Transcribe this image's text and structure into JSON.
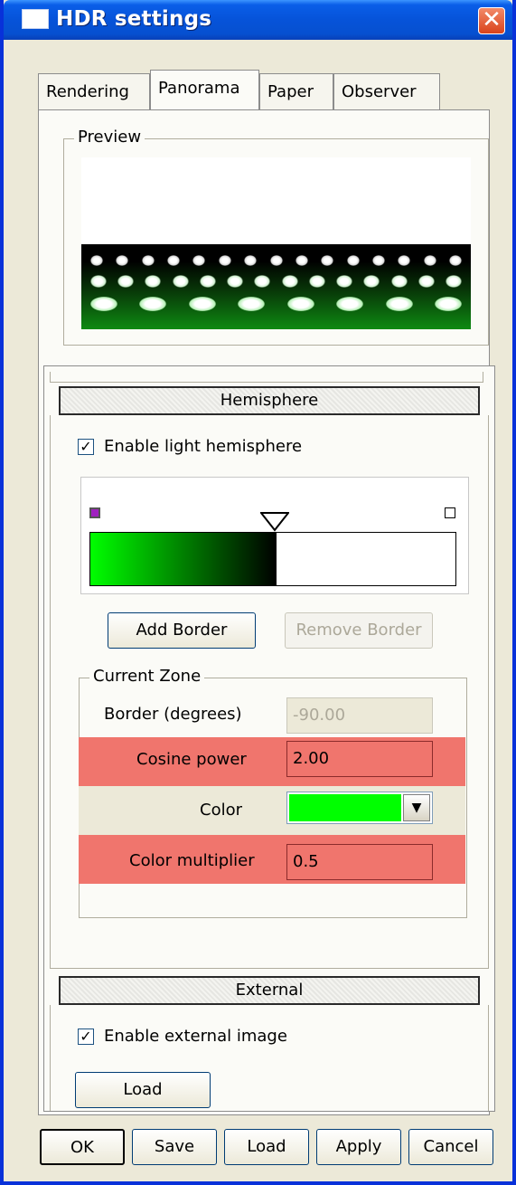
{
  "window": {
    "title": "HDR settings",
    "close_glyph": "✕"
  },
  "tabs": [
    {
      "label": "Rendering"
    },
    {
      "label": "Panorama"
    },
    {
      "label": "Paper"
    },
    {
      "label": "Observer"
    }
  ],
  "preview": {
    "title": "Preview"
  },
  "hemisphere": {
    "header": "Hemisphere",
    "enable_checked": true,
    "enable_label": "Enable light hemisphere",
    "gradient_colors": [
      "#00ff00",
      "#000000",
      "#ffffff"
    ],
    "add_border_label": "Add Border",
    "remove_border_label": "Remove Border",
    "current_zone": {
      "title": "Current Zone",
      "border_label": "Border (degrees)",
      "border_value": "-90.00",
      "cosine_label": "Cosine power",
      "cosine_value": "2.00",
      "color_label": "Color",
      "color_value": "#00ff00",
      "multiplier_label": "Color multiplier",
      "multiplier_value": "0.5"
    }
  },
  "external": {
    "header": "External",
    "enable_checked": true,
    "enable_label": "Enable external image",
    "load_label": "Load"
  },
  "footer": {
    "ok": "OK",
    "save": "Save",
    "load": "Load",
    "apply": "Apply",
    "cancel": "Cancel"
  },
  "checkmark_glyph": "✓",
  "dropdown_arrow_glyph": "▼"
}
